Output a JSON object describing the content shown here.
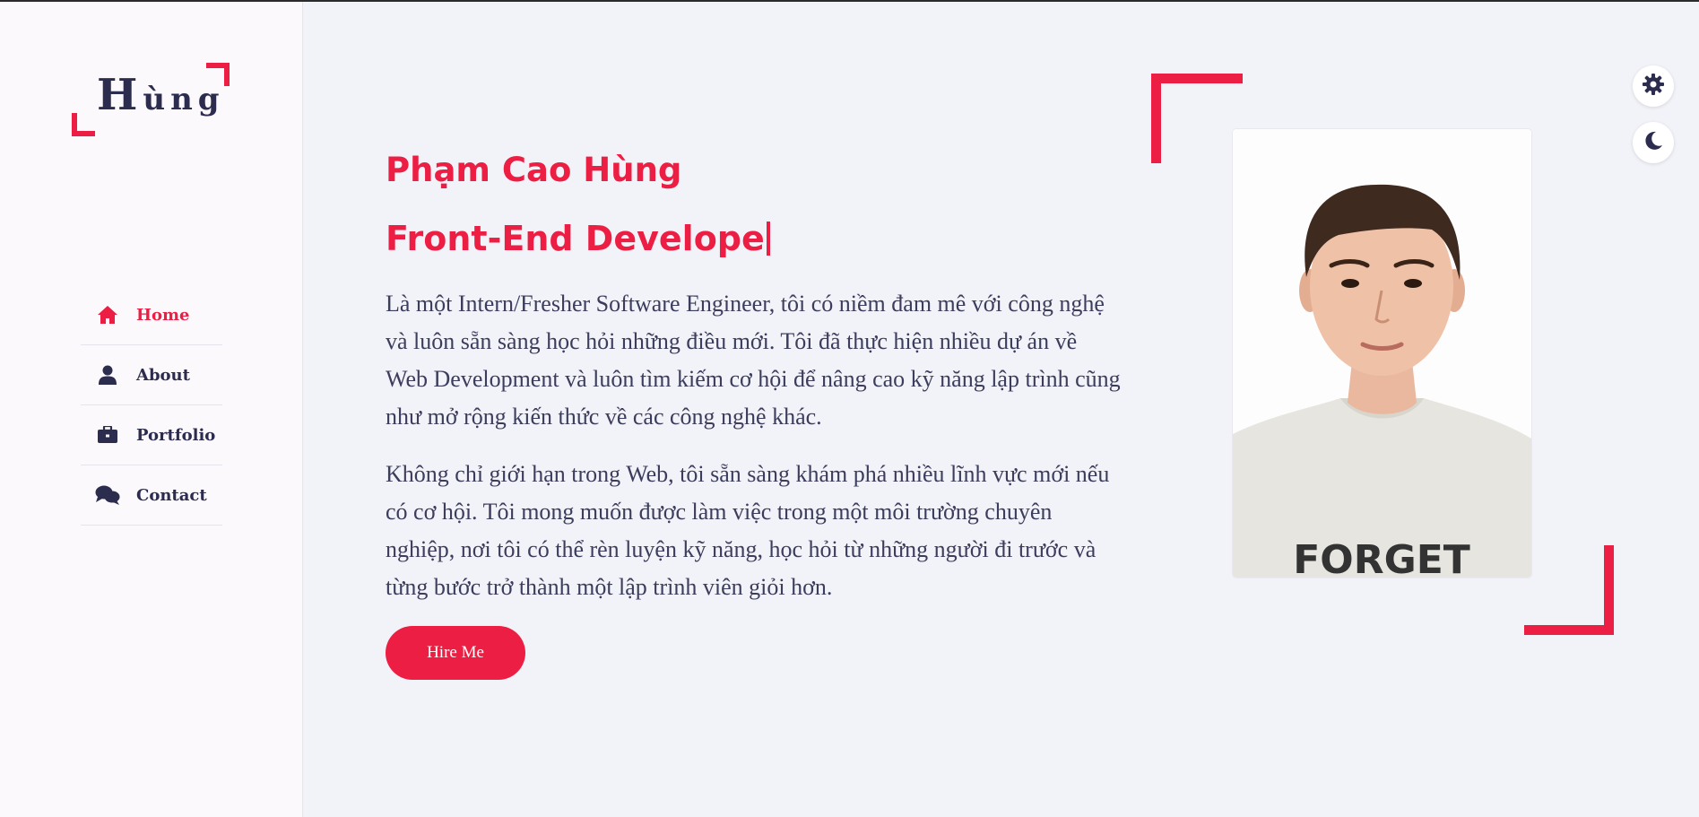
{
  "logo": {
    "first_letter": "H",
    "rest": "ùng"
  },
  "nav": {
    "items": [
      {
        "label": "Home",
        "icon": "home-icon",
        "active": true
      },
      {
        "label": "About",
        "icon": "user-icon",
        "active": false
      },
      {
        "label": "Portfolio",
        "icon": "briefcase-icon",
        "active": false
      },
      {
        "label": "Contact",
        "icon": "chat-icon",
        "active": false
      }
    ]
  },
  "hero": {
    "name": "Phạm Cao Hùng",
    "role": "Front-End Develope",
    "paragraph1": "Là một Intern/Fresher Software Engineer, tôi có niềm đam mê với công nghệ và luôn sẵn sàng học hỏi những điều mới. Tôi đã thực hiện nhiều dự án về Web Development và luôn tìm kiếm cơ hội để nâng cao kỹ năng lập trình cũng như mở rộng kiến thức về các công nghệ khác.",
    "paragraph2": "Không chỉ giới hạn trong Web, tôi sẵn sàng khám phá nhiều lĩnh vực mới nếu có cơ hội. Tôi mong muốn được làm việc trong một môi trường chuyên nghiệp, nơi tôi có thể rèn luyện kỹ năng, học hỏi từ những người đi trước và từng bước trở thành một lập trình viên giỏi hơn.",
    "hire_label": "Hire Me"
  },
  "photo": {
    "shirt_text": "FORGET"
  },
  "controls": {
    "settings_icon": "gear-icon",
    "theme_icon": "moon-icon"
  },
  "colors": {
    "accent": "#ed1e43",
    "navy": "#2c2c4f",
    "background": "#f2f3f9",
    "sidebar": "#fcf9fd"
  }
}
